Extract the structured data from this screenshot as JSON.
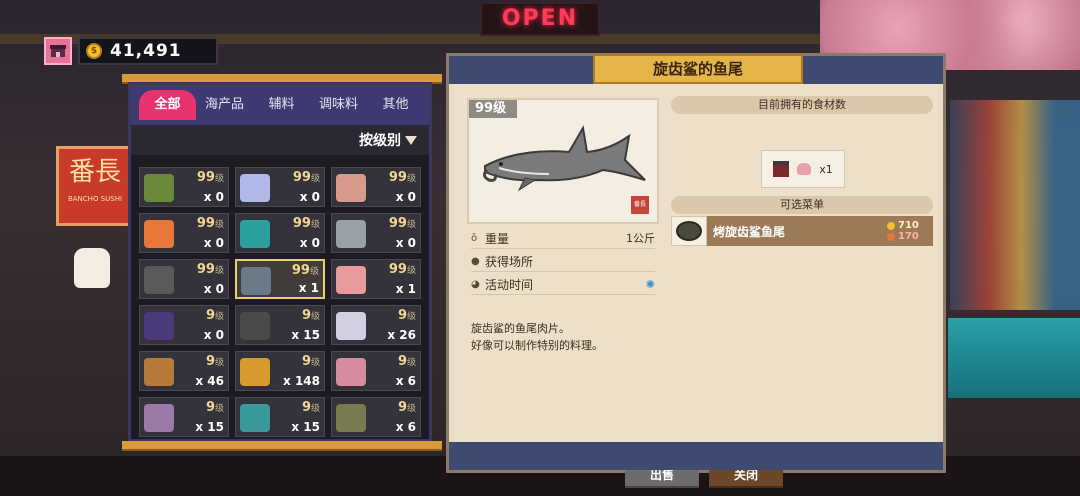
{
  "background": {
    "neon_sign": "OPEN",
    "restaurant_sign": "番長",
    "restaurant_sign_small": "BANCHO SUSHI"
  },
  "wallet": {
    "amount": "41,491",
    "coin_symbol": "$",
    "store_icon": "store-icon"
  },
  "inventory": {
    "tabs": [
      "全部",
      "海产品",
      "辅料",
      "调味料",
      "其他"
    ],
    "active_tab": "全部",
    "sort_label": "按级别",
    "level_suffix": "级",
    "items": [
      {
        "level": "99",
        "qty": "x 0",
        "color": "#6a8a3a"
      },
      {
        "level": "99",
        "qty": "x 0",
        "color": "#b0b8e8"
      },
      {
        "level": "99",
        "qty": "x 0",
        "color": "#d89a8a"
      },
      {
        "level": "99",
        "qty": "x 0",
        "color": "#e8783a"
      },
      {
        "level": "99",
        "qty": "x 0",
        "color": "#2aa0a0"
      },
      {
        "level": "99",
        "qty": "x 0",
        "color": "#9aa0a8"
      },
      {
        "level": "99",
        "qty": "x 0",
        "color": "#5a5a5a"
      },
      {
        "level": "99",
        "qty": "x 1",
        "color": "#6a7a88"
      },
      {
        "level": "99",
        "qty": "x 1",
        "color": "#e89a9a"
      },
      {
        "level": "9",
        "qty": "x 0",
        "color": "#4a3a7a"
      },
      {
        "level": "9",
        "qty": "x 15",
        "color": "#4a4a4a"
      },
      {
        "level": "9",
        "qty": "x 26",
        "color": "#d0d0e0"
      },
      {
        "level": "9",
        "qty": "x 46",
        "color": "#b8783a"
      },
      {
        "level": "9",
        "qty": "x 148",
        "color": "#d89a30"
      },
      {
        "level": "9",
        "qty": "x 6",
        "color": "#d88aa0"
      },
      {
        "level": "9",
        "qty": "x 15",
        "color": "#9a7aa8"
      },
      {
        "level": "9",
        "qty": "x 15",
        "color": "#3a9a9a"
      },
      {
        "level": "9",
        "qty": "x 6",
        "color": "#7a7a50"
      }
    ],
    "selected_index": 7
  },
  "detail": {
    "title": "旋齿鲨的鱼尾",
    "level": "99级",
    "stamp": "番長",
    "weight_label": "重量",
    "weight_value": "1公斤",
    "location_label": "获得场所",
    "event_label": "活动时间",
    "description_lines": [
      "旋齿鲨的鱼尾肉片。",
      "好像可以制作特别的料理。"
    ],
    "owned_header": "目前拥有的食材数",
    "owned_count": "x1",
    "menu_header": "可选菜单",
    "menu": {
      "name": "烤旋齿鲨鱼尾",
      "price_gold": "710",
      "price_red": "170"
    },
    "sell_button": "出售",
    "close_button": "关闭"
  }
}
